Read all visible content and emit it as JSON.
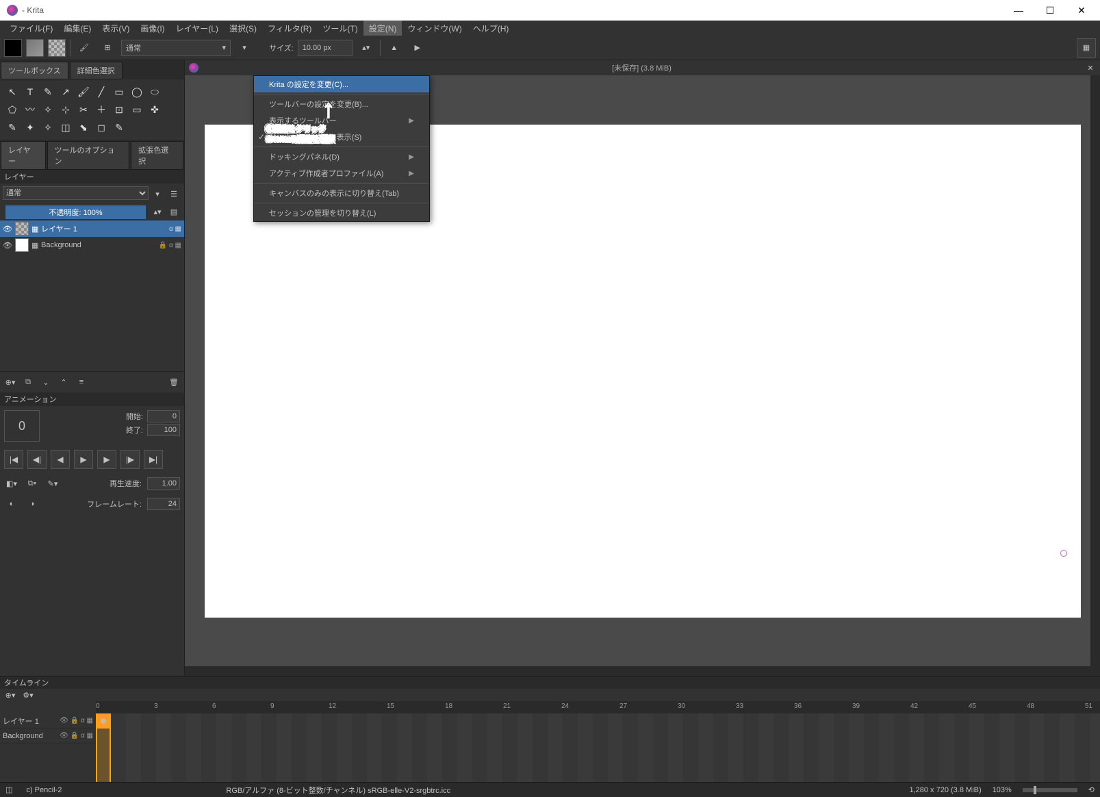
{
  "app": {
    "title": "- Krita"
  },
  "menubar": {
    "items": [
      "ファイル(F)",
      "編集(E)",
      "表示(V)",
      "画像(I)",
      "レイヤー(L)",
      "選択(S)",
      "フィルタ(R)",
      "ツール(T)",
      "設定(N)",
      "ウィンドウ(W)",
      "ヘルプ(H)"
    ],
    "open_index": 8
  },
  "dropdown": {
    "items": [
      {
        "label": "Krita の設定を変更(C)...",
        "hl": true
      },
      {
        "label": "ツールバーの設定を変更(B)...",
        "sep_before": true
      },
      {
        "label": "表示するツールバー",
        "submenu": true
      },
      {
        "label": "ドッキングパネルを表示(S)",
        "checked": true
      },
      {
        "label": "ドッキングパネル(D)",
        "submenu": true,
        "sep_before": true
      },
      {
        "label": "アクティブ作成者プロファイル(A)",
        "submenu": true
      },
      {
        "label": "キャンバスのみの表示に切り替え(Tab)",
        "sep_before": true
      },
      {
        "label": "セッションの管理を切り替え(L)",
        "sep_before": true
      }
    ]
  },
  "toolbar": {
    "blend_mode": "通常",
    "size_label": "サイズ:",
    "size_value": "10.00 px"
  },
  "doc": {
    "title": "[未保存]  (3.8 MiB)"
  },
  "panels": {
    "toolbox_tab": "ツールボックス",
    "color_tab": "詳細色選択",
    "layer_tab": "レイヤー",
    "tool_options_tab": "ツールのオプション",
    "ext_color_tab": "拡張色選択",
    "layers_title": "レイヤー",
    "blend": "通常",
    "opacity": "不透明度: 100%",
    "layers": [
      {
        "name": "レイヤー 1",
        "selected": true,
        "thumb": "checker"
      },
      {
        "name": "Background",
        "selected": false,
        "thumb": "white",
        "locked": true
      }
    ]
  },
  "animation": {
    "title": "アニメーション",
    "start_label": "開始:",
    "start_value": "0",
    "end_label": "終了:",
    "end_value": "100",
    "current": "0",
    "speed_label": "再生速度:",
    "speed_value": "1.00",
    "fps_label": "フレームレート:",
    "fps_value": "24"
  },
  "timeline": {
    "title": "タイムライン",
    "tracks": [
      "レイヤー 1",
      "Background"
    ],
    "ticks": [
      0,
      3,
      6,
      9,
      12,
      15,
      18,
      21,
      24,
      27,
      30,
      33,
      36,
      39,
      42,
      45,
      48,
      51
    ]
  },
  "status": {
    "brush": "c) Pencil-2",
    "profile": "RGB/アルファ (8-ビット整数/チャンネル)  sRGB-elle-V2-srgbtrc.icc",
    "dims": "1,280 x 720 (3.8 MiB)",
    "zoom": "103%"
  },
  "annotations": {
    "line1": "①設定をクリック",
    "line2": "②Kritaの設定を選択"
  }
}
